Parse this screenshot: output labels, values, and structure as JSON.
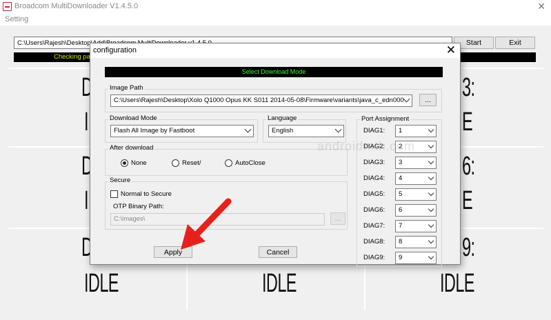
{
  "window": {
    "title": "Broadcom MultiDownloader V1.4.5.0",
    "close_glyph": "✕",
    "menu": [
      "Setting"
    ]
  },
  "main": {
    "path_value": "C:\\Users\\Rajesh\\Desktop\\Add\\Broadcom MultiDownloader v1.4.5.0",
    "start_label": "Start",
    "exit_label": "Exit",
    "status_text": "Checking pac",
    "cells": {
      "top_left": "D",
      "top_right": "3:",
      "row1_left": "I",
      "row1_right": "E",
      "mid_left": "D",
      "mid_right": "6:",
      "row2_left": "I",
      "row2_right": "E",
      "low_left": "D",
      "low_right": "9:",
      "idle_1": "IDLE",
      "idle_2": "IDLE",
      "idle_3": "IDLE"
    },
    "accent_color": "#c8e600"
  },
  "dialog": {
    "title": "configuration",
    "close_glyph": "✕",
    "mode_banner": "Select Download Mode",
    "banner_color": "#39ff39",
    "image_path": {
      "label": "Image Path",
      "value": "C:\\Users\\Rajesh\\Desktop\\Xolo Q1000 Opus KK S011 2014-05-08\\Firmware\\variants\\java_c_edn000",
      "browse_label": "..."
    },
    "download_mode": {
      "label": "Download Mode",
      "value": "Flash All Image by Fastboot"
    },
    "language": {
      "label": "Language",
      "value": "English"
    },
    "after_download": {
      "label": "After download",
      "options": [
        {
          "label": "None",
          "selected": true
        },
        {
          "label": "Reset/",
          "selected": false
        },
        {
          "label": "AutoClose",
          "selected": false
        }
      ]
    },
    "secure": {
      "label": "Secure",
      "checkbox_label": "Normal to Secure",
      "otp_label": "OTP Binary Path:",
      "otp_value": "C:\\images\\",
      "browse_label": "..."
    },
    "port_assignment": {
      "label": "Port Assignment",
      "ports": [
        {
          "name": "DIAG1:",
          "value": "1"
        },
        {
          "name": "DIAG2:",
          "value": "2"
        },
        {
          "name": "DIAG3:",
          "value": "3"
        },
        {
          "name": "DIAG4:",
          "value": "4"
        },
        {
          "name": "DIAG5:",
          "value": "5"
        },
        {
          "name": "DIAG6:",
          "value": "6"
        },
        {
          "name": "DIAG7:",
          "value": "7"
        },
        {
          "name": "DIAG8:",
          "value": "8"
        },
        {
          "name": "DIAG9:",
          "value": "9"
        }
      ]
    },
    "apply_label": "Apply",
    "cancel_label": "Cancel"
  },
  "watermark": "androidmtk.com",
  "annotation": {
    "icon": "red-arrow-icon",
    "color": "#e8201c"
  }
}
